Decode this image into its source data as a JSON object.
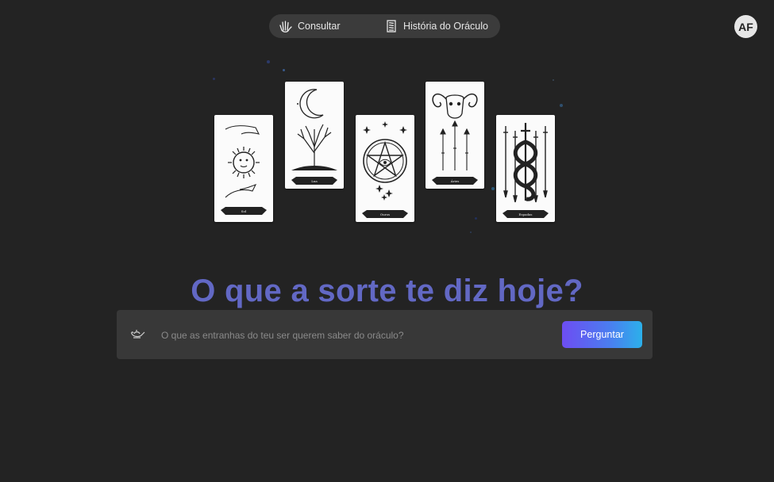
{
  "nav": {
    "consult_label": "Consultar",
    "consult_icon": "hand-icon",
    "history_label": "História do Oráculo",
    "history_icon": "scroll-icon"
  },
  "user": {
    "initials": "AF"
  },
  "hero": {
    "headline": "O que a sorte te diz hoje?"
  },
  "cards": [
    {
      "icon": "sun-hands-card",
      "banner": "Sol"
    },
    {
      "icon": "moon-tree-card",
      "banner": "Lua"
    },
    {
      "icon": "pentacle-eye-card",
      "banner": "Ouros"
    },
    {
      "icon": "ram-skull-arrows-card",
      "banner": "Áries"
    },
    {
      "icon": "serpent-swords-card",
      "banner": "Espadas"
    }
  ],
  "ask": {
    "icon": "genie-lamp-icon",
    "placeholder": "O que as entranhas do teu ser querem saber do oráculo?",
    "value": "",
    "button_label": "Perguntar"
  },
  "colors": {
    "background": "#232323",
    "headline": "#6268c4",
    "button_gradient": [
      "#6d4df2",
      "#2cb0ea"
    ]
  }
}
